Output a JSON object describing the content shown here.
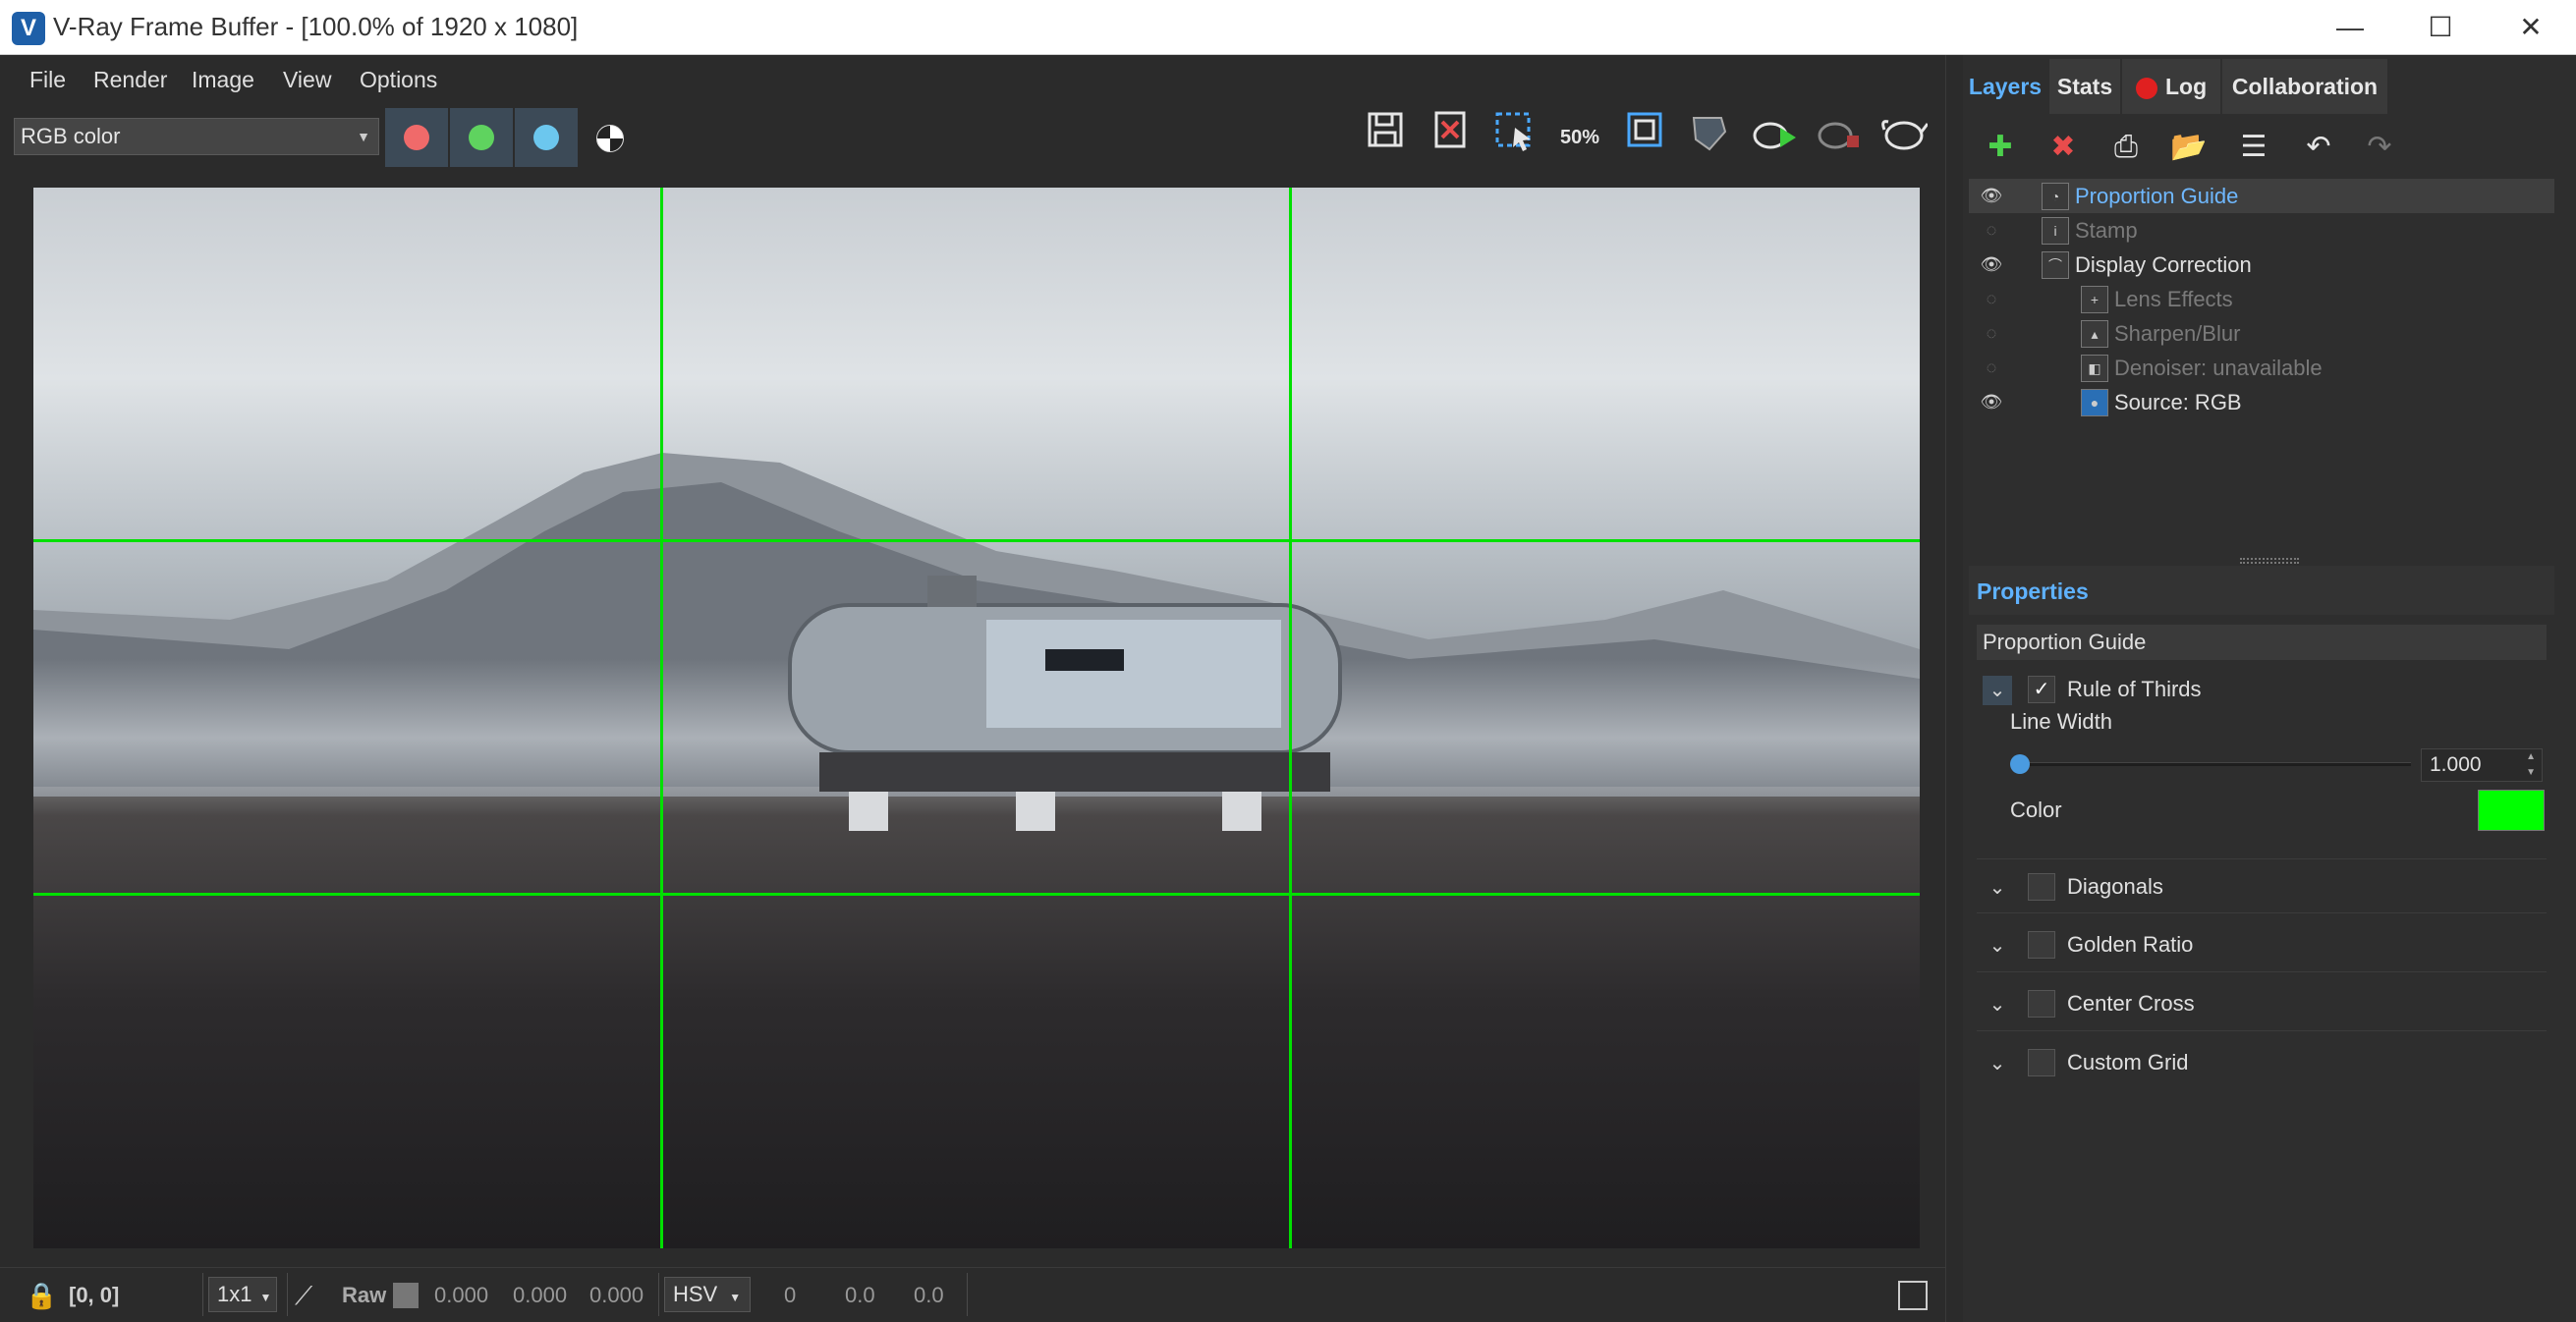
{
  "window": {
    "title": "V-Ray Frame Buffer - [100.0% of 1920 x 1080]",
    "logo": "V",
    "minimize": "—",
    "maximize": "☐",
    "close": "✕"
  },
  "menu": [
    "File",
    "Render",
    "Image",
    "View",
    "Options"
  ],
  "toolbar": {
    "channel": "RGB color",
    "channel_colors": {
      "red": "#f06a6a",
      "green": "#5fd35f",
      "blue": "#6cc7ee"
    },
    "icons": [
      "save-icon",
      "clear-image-icon",
      "region-render-icon",
      "zoom-50-icon",
      "fit-icon",
      "compare-icon",
      "start-interactive-icon",
      "stop-render-icon",
      "render-icon"
    ],
    "zoom_label": "50%"
  },
  "tabs": [
    "Layers",
    "Stats",
    "Log",
    "Collaboration"
  ],
  "layers": [
    {
      "name": "Proportion Guide",
      "visible": true,
      "selected": true,
      "indent": 0
    },
    {
      "name": "Stamp",
      "visible": false,
      "indent": 0
    },
    {
      "name": "Display Correction",
      "visible": true,
      "indent": 0
    },
    {
      "name": "Lens Effects",
      "visible": false,
      "indent": 1
    },
    {
      "name": "Sharpen/Blur",
      "visible": false,
      "indent": 1
    },
    {
      "name": "Denoiser: unavailable",
      "visible": false,
      "indent": 1
    },
    {
      "name": "Source: RGB",
      "visible": true,
      "indent": 1
    }
  ],
  "properties": {
    "title": "Properties",
    "layer_name": "Proportion Guide",
    "sections": [
      {
        "label": "Rule of Thirds",
        "checked": true
      },
      {
        "label": "Diagonals",
        "checked": false
      },
      {
        "label": "Golden Ratio",
        "checked": false
      },
      {
        "label": "Center Cross",
        "checked": false
      },
      {
        "label": "Custom Grid",
        "checked": false
      }
    ],
    "line_width_label": "Line Width",
    "line_width_value": "1.000",
    "color_label": "Color",
    "color_value": "#00ff00"
  },
  "statusbar": {
    "coords": "[0, 0]",
    "sampling": "1x1",
    "raw_label": "Raw",
    "r": "0.000",
    "g": "0.000",
    "b": "0.000",
    "color_mode": "HSV",
    "h": "0",
    "s": "0.0",
    "v": "0.0"
  }
}
